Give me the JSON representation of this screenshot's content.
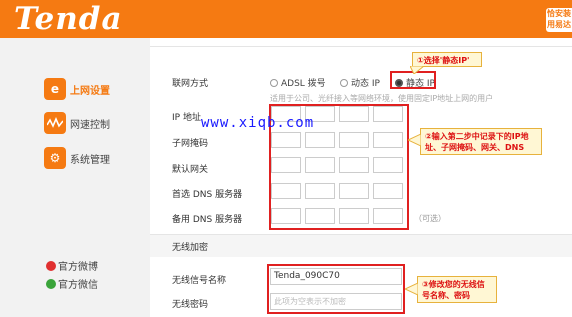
{
  "brand": {
    "logo": "Tenda",
    "header_button": "恰安装 用易达"
  },
  "sidebar": {
    "items": [
      {
        "label": "上网设置",
        "icon": "e-internet-icon",
        "active": true
      },
      {
        "label": "网速控制",
        "icon": "speed-wave-icon",
        "active": false
      },
      {
        "label": "系统管理",
        "icon": "gear-icon",
        "active": false
      }
    ],
    "social": [
      {
        "label": "官方微博",
        "icon": "weibo-icon"
      },
      {
        "label": "官方微信",
        "icon": "wechat-icon"
      }
    ]
  },
  "form": {
    "connection_label": "联网方式",
    "options": [
      {
        "label": "ADSL 拨号",
        "selected": false
      },
      {
        "label": "动态 IP",
        "selected": false
      },
      {
        "label": "静态 IP",
        "selected": true
      }
    ],
    "hint": "适用于公司、光纤接入等网络环境，使用固定IP地址上网的用户",
    "ip_label": "IP 地址",
    "mask_label": "子网掩码",
    "gateway_label": "默认网关",
    "dns1_label": "首选 DNS 服务器",
    "dns2_label": "备用 DNS 服务器",
    "optional": "（可选）",
    "wireless_section": "无线加密",
    "ssid_label": "无线信号名称",
    "ssid_value": "Tenda_090C70",
    "password_label": "无线密码",
    "password_placeholder": "此项为空表示不加密"
  },
  "annotations": {
    "step1": "①选择'静态IP'",
    "step2": "②输入第二步中记录下的IP地址、子网掩码、网关、DNS",
    "step3": "③修改您的无线信号名称、密码",
    "watermark": "www.xiqb.com"
  },
  "colors": {
    "brand_orange": "#f57a12",
    "annotation_red": "#e02020",
    "callout_bg": "#fff7d4"
  }
}
